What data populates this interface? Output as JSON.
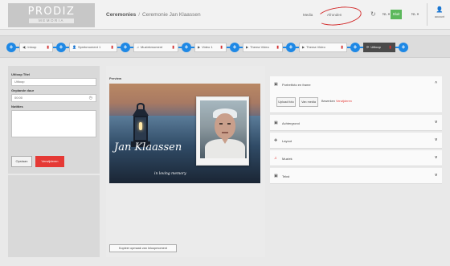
{
  "header": {
    "logo_top": "PRODIZ",
    "logo_sub": "MEMORIA",
    "breadcrumb_root": "Ceremonies",
    "breadcrumb_sep": "/",
    "breadcrumb_current": "Ceremonie Jan Klaassen",
    "media_label": "Media",
    "afronden_label": "Afronden",
    "undo_icon": "↻",
    "lang1": "NL ▾",
    "save_label": "Sluit",
    "lang2": "NL ▾",
    "account_icon": "👤",
    "account_label": "account"
  },
  "steps": [
    {
      "icon": "◀)",
      "label": "Inloop"
    },
    {
      "icon": "👤",
      "label": "Sprekmoment 1"
    },
    {
      "icon": "♫",
      "label": "Muziekmoment"
    },
    {
      "icon": "▶",
      "label": "Video 1"
    },
    {
      "icon": "▶",
      "label": "Thema Video"
    },
    {
      "icon": "▶",
      "label": "Thema Video"
    },
    {
      "icon": "⟳",
      "label": "Uitloop"
    }
  ],
  "form": {
    "title_label": "Uitloop Titel",
    "title_value": "Uitloop",
    "duration_label": "Geplande duur",
    "duration_value": "00:00",
    "notes_label": "Notities",
    "save_button": "Opslaan",
    "delete_button": "Verwijderen"
  },
  "preview": {
    "label": "Preview",
    "name_text": "Jan Klaassen",
    "memory_text": "in loving memory",
    "keep_ratio_button": "Kopieer opmaak van Inloopmoment"
  },
  "panels": {
    "portrait": {
      "icon": "▣",
      "label": "Portretfoto en frame",
      "chevron": "^"
    },
    "upload_button": "Upload foto",
    "from_media_button": "Van media",
    "edit_link": "Bewerken",
    "delete_link": "Verwijderen",
    "background": {
      "icon": "▣",
      "label": "Achtergrond",
      "chevron": "v"
    },
    "layout": {
      "icon": "✥",
      "label": "Layout",
      "chevron": "v"
    },
    "music": {
      "icon": "♫",
      "label": "Muziek",
      "chevron": "v"
    },
    "text": {
      "icon": "▣",
      "label": "Tekst",
      "chevron": "v"
    }
  },
  "colors": {
    "accent_blue": "#1e88e5",
    "danger_red": "#e53935",
    "save_green": "#5cb85c"
  }
}
